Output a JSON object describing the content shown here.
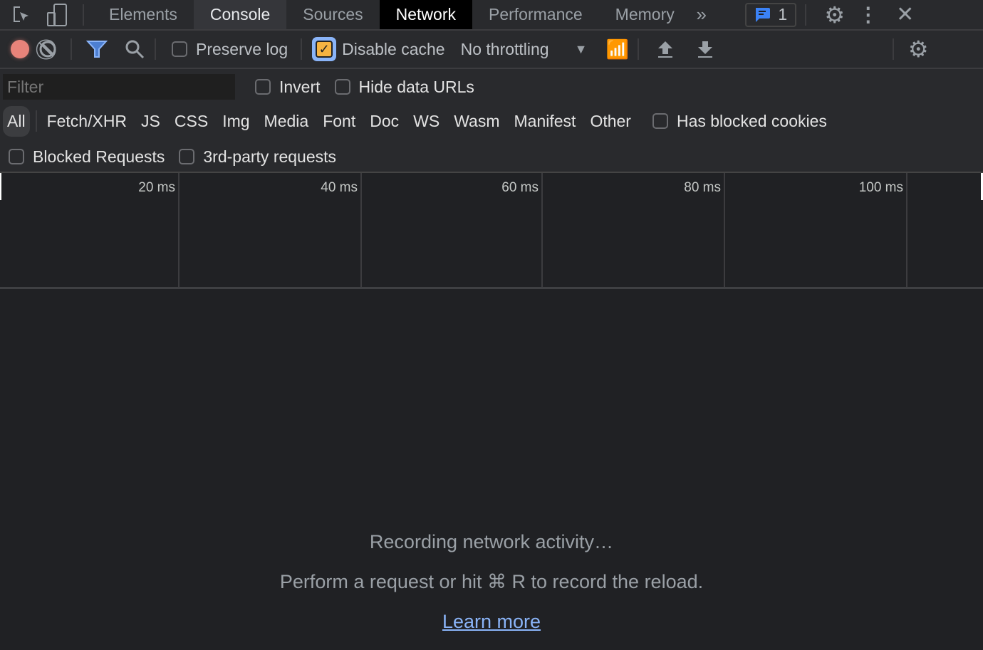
{
  "tabs": [
    "Elements",
    "Console",
    "Sources",
    "Network",
    "Performance",
    "Memory"
  ],
  "active_tab": "Network",
  "issues_count": "1",
  "toolbar": {
    "preserve_log": "Preserve log",
    "preserve_log_checked": false,
    "disable_cache": "Disable cache",
    "disable_cache_checked": true,
    "throttling": "No throttling"
  },
  "filter": {
    "placeholder": "Filter",
    "invert": "Invert",
    "hide_data_urls": "Hide data URLs",
    "types": [
      "All",
      "Fetch/XHR",
      "JS",
      "CSS",
      "Img",
      "Media",
      "Font",
      "Doc",
      "WS",
      "Wasm",
      "Manifest",
      "Other"
    ],
    "selected_type": "All",
    "has_blocked_cookies": "Has blocked cookies",
    "blocked_requests": "Blocked Requests",
    "third_party": "3rd-party requests"
  },
  "overview": {
    "ticks": [
      "20 ms",
      "40 ms",
      "60 ms",
      "80 ms",
      "100 ms"
    ]
  },
  "empty": {
    "title": "Recording network activity…",
    "hint": "Perform a request or hit ⌘ R to record the reload.",
    "link": "Learn more"
  },
  "colors": {
    "record": "#e8837a",
    "accent": "#8ab4f8",
    "checkbox": "#f5b342",
    "issues": "#3b82f6"
  }
}
